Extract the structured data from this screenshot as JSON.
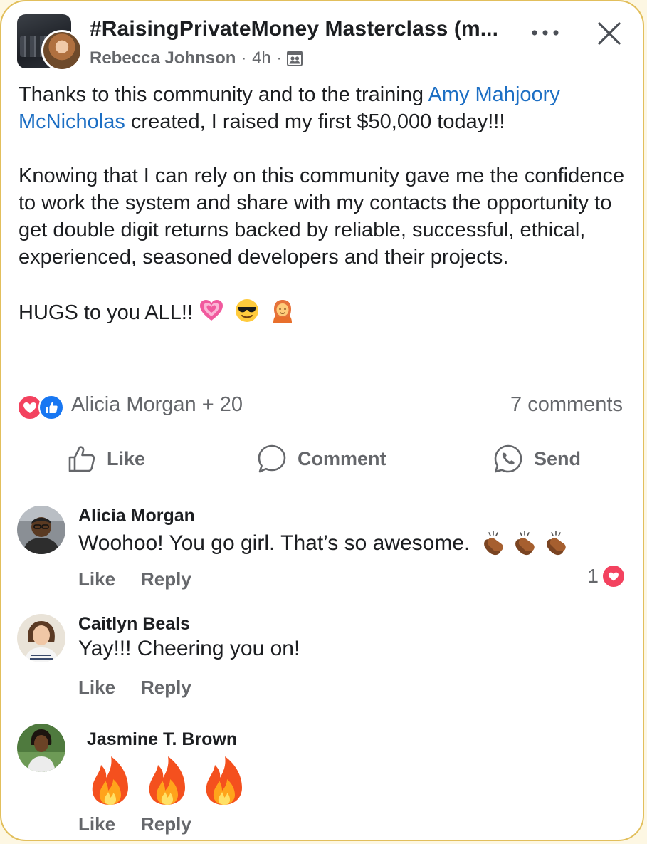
{
  "post": {
    "group_title": "#RaisingPrivateMoney Masterclass (m...",
    "author": "Rebecca Johnson",
    "time": "4h",
    "separator": "·",
    "body": {
      "p1_before": "Thanks to this community and to the training ",
      "mention": "Amy Mahjoory McNicholas",
      "p1_after": " created, I raised my first $50,000 today!!!",
      "p2": "Knowing that I can rely on this community gave me the confidence to work the system and share with my contacts the opportunity to get double digit returns backed by reliable, successful, ethical, experienced, seasoned developers and their projects.",
      "p3": "HUGS to you ALL!!",
      "p3_emojis": [
        "sparkling-heart-emoji",
        "sunglasses-face-emoji",
        "person-tipping-hand-emoji"
      ]
    },
    "reactions": {
      "icons": [
        "love-reaction-icon",
        "like-reaction-icon"
      ],
      "summary": "Alicia Morgan + 20",
      "comments_count": "7 comments"
    },
    "actions": {
      "like": "Like",
      "comment": "Comment",
      "send": "Send"
    }
  },
  "comments": [
    {
      "name": "Alicia Morgan",
      "text": "Woohoo! You go girl. That’s so awesome.",
      "emojis": [
        "clapping-hands-emoji",
        "clapping-hands-emoji",
        "clapping-hands-emoji"
      ],
      "like": "Like",
      "reply": "Reply",
      "reaction_count": "1"
    },
    {
      "name": "Caitlyn Beals",
      "text": "Yay!!! Cheering you on!",
      "like": "Like",
      "reply": "Reply"
    },
    {
      "name": "Jasmine T. Brown",
      "text": "",
      "emojis": [
        "fire-emoji",
        "fire-emoji",
        "fire-emoji"
      ],
      "like": "Like",
      "reply": "Reply"
    }
  ],
  "colors": {
    "accent_link": "#1d6fc4",
    "secondary_text": "#65676b",
    "love_red": "#f3425f",
    "like_blue": "#1877f2",
    "frame_gold": "#e2bf5c"
  }
}
